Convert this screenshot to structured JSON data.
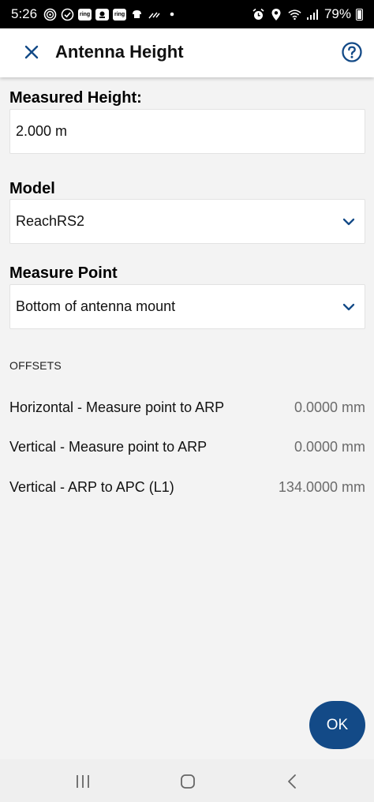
{
  "status_bar": {
    "time": "5:26",
    "left_icons": [
      "signal-circle-icon",
      "check-circle-icon",
      "ring-icon",
      "app-icon",
      "ring-icon",
      "chef-icon",
      "tool-icon",
      "dot-icon"
    ],
    "ring_label": "ring",
    "battery": "79%",
    "right_icons": [
      "alarm-icon",
      "location-icon",
      "wifi-icon",
      "cell-signal-icon",
      "battery-icon"
    ]
  },
  "app_bar": {
    "title": "Antenna Height",
    "accent_color": "#134a87"
  },
  "form": {
    "measured_height_label": "Measured Height:",
    "measured_height_value": "2.000 m",
    "model_label": "Model",
    "model_value": "ReachRS2",
    "measure_point_label": "Measure Point",
    "measure_point_value": "Bottom of antenna mount"
  },
  "offsets": {
    "heading": "OFFSETS",
    "rows": [
      {
        "label": "Horizontal - Measure point to ARP",
        "value": "0.0000 mm"
      },
      {
        "label": "Vertical - Measure point to ARP",
        "value": "0.0000 mm"
      },
      {
        "label": "Vertical - ARP to APC (L1)",
        "value": "134.0000 mm"
      }
    ]
  },
  "ok_button": {
    "label": "OK"
  },
  "nav_bar": {
    "items": [
      "recent-apps-icon",
      "home-icon",
      "back-icon"
    ]
  }
}
